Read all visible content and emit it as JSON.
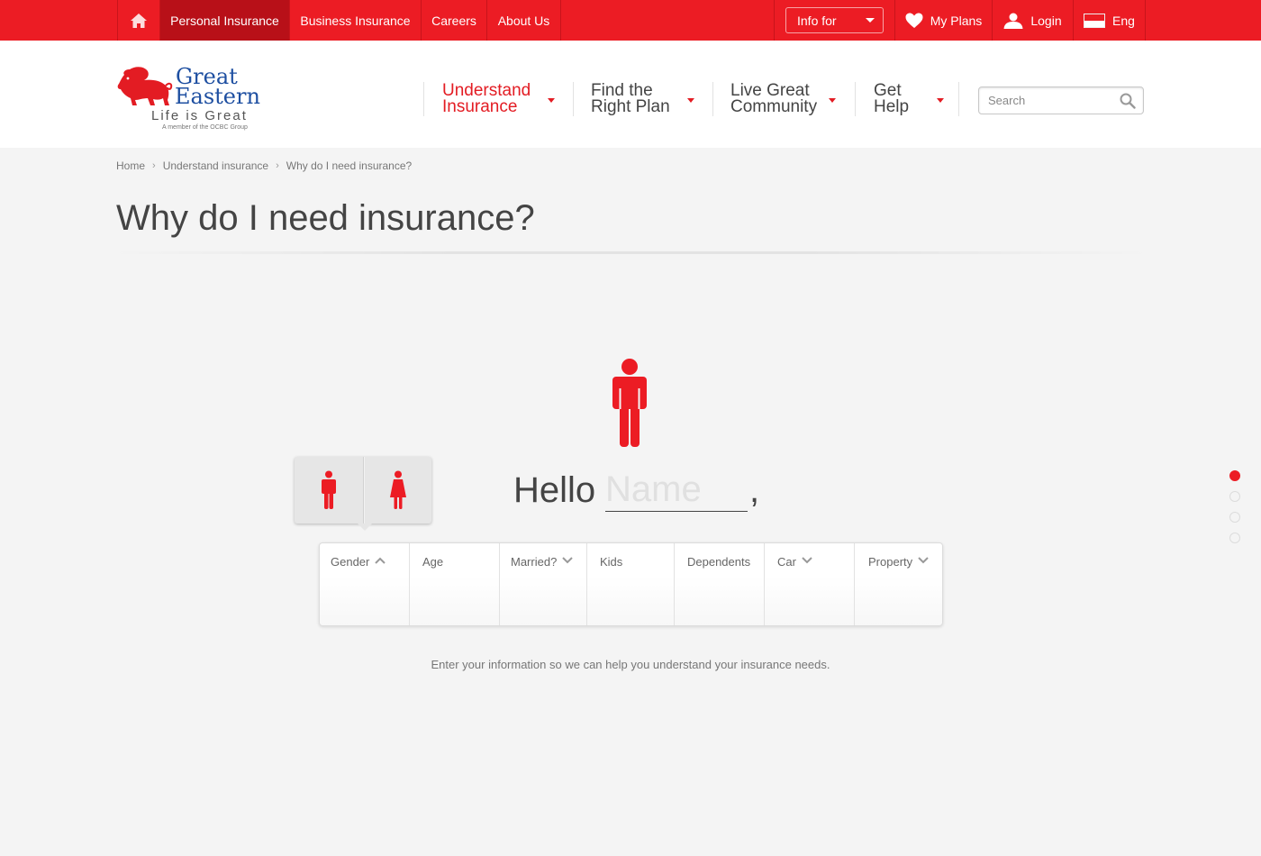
{
  "topnav": {
    "home_icon": "home-icon",
    "items": [
      "Personal Insurance",
      "Business Insurance",
      "Careers",
      "About Us"
    ],
    "active_item": "Personal Insurance",
    "info_for": "Info for",
    "my_plans": "My Plans",
    "login": "Login",
    "language": "Eng",
    "accent_color": "#ec1c24"
  },
  "logo": {
    "line1": "Great",
    "line2": "Eastern",
    "tagline": "Life is Great",
    "member": "A member of the OCBC Group"
  },
  "mainnav": [
    {
      "line1": "Understand",
      "line2": "Insurance",
      "active": true
    },
    {
      "line1": "Find the",
      "line2": "Right Plan",
      "active": false
    },
    {
      "line1": "Live Great",
      "line2": "Community",
      "active": false
    },
    {
      "line1": "Get",
      "line2": "Help",
      "active": false
    }
  ],
  "search": {
    "placeholder": "Search"
  },
  "breadcrumb": [
    "Home",
    "Understand insurance",
    "Why do I need insurance?"
  ],
  "page_title": "Why do I need insurance?",
  "hello": {
    "greeting": "Hello",
    "name_placeholder": "Name",
    "comma": ","
  },
  "gender_options": [
    "male-figure-icon",
    "female-figure-icon"
  ],
  "fields": [
    {
      "label": "Gender",
      "chevron": "up"
    },
    {
      "label": "Age",
      "chevron": ""
    },
    {
      "label": "Married?",
      "chevron": "down"
    },
    {
      "label": "Kids",
      "chevron": ""
    },
    {
      "label": "Dependents",
      "chevron": ""
    },
    {
      "label": "Car",
      "chevron": "down"
    },
    {
      "label": "Property",
      "chevron": "down"
    }
  ],
  "helper_text": "Enter your information so we can help you understand your insurance needs.",
  "pagination": {
    "total": 4,
    "current": 1
  }
}
